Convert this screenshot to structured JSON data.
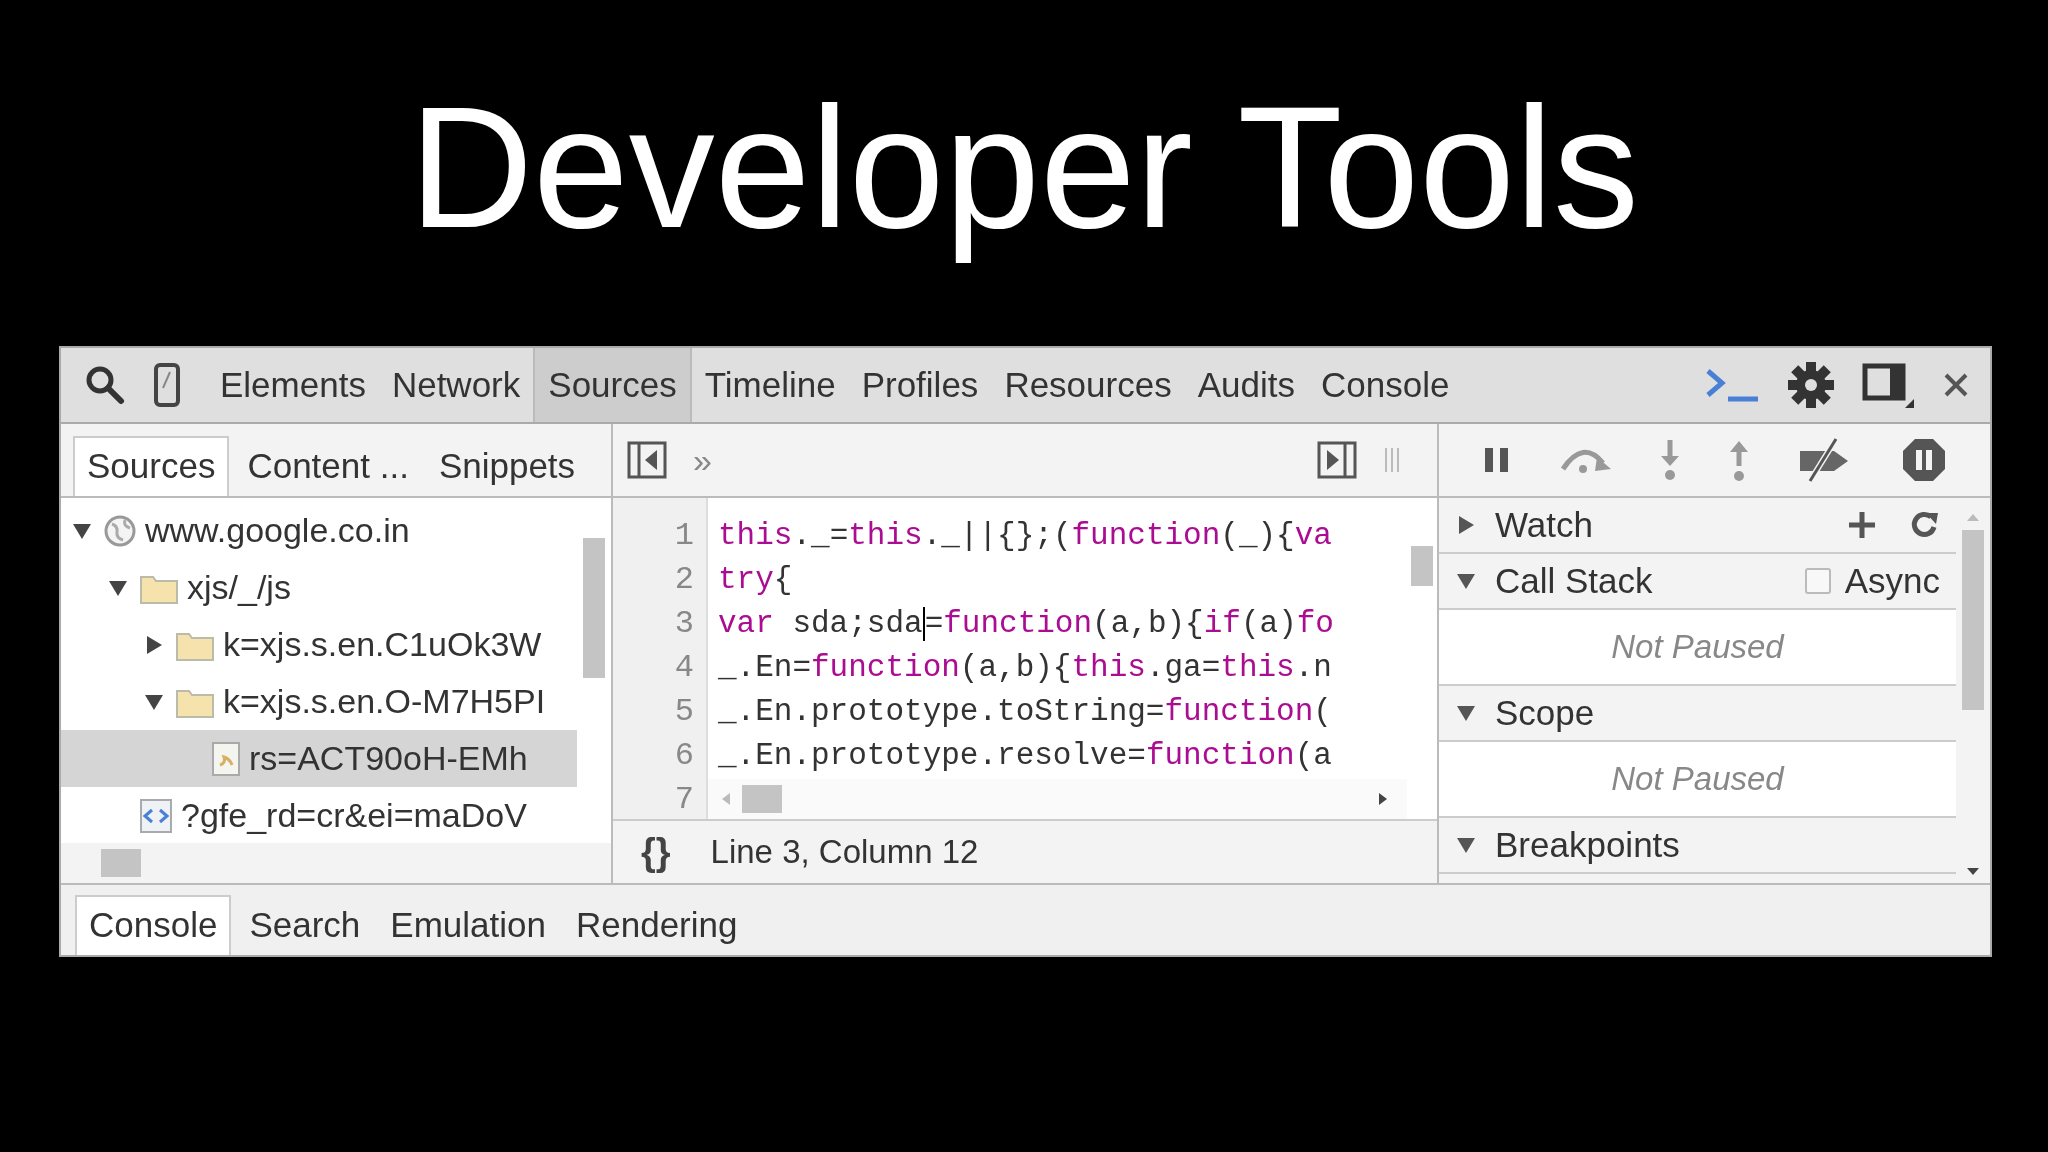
{
  "slide_title": "Developer Tools",
  "main_tabs": [
    {
      "label": "Elements",
      "selected": false
    },
    {
      "label": "Network",
      "selected": false
    },
    {
      "label": "Sources",
      "selected": true
    },
    {
      "label": "Timeline",
      "selected": false
    },
    {
      "label": "Profiles",
      "selected": false
    },
    {
      "label": "Resources",
      "selected": false
    },
    {
      "label": "Audits",
      "selected": false
    },
    {
      "label": "Console",
      "selected": false
    }
  ],
  "navigator": {
    "tabs": [
      {
        "label": "Sources",
        "selected": true
      },
      {
        "label": "Content ...",
        "selected": false
      },
      {
        "label": "Snippets",
        "selected": false
      }
    ],
    "tree": [
      {
        "label": "www.google.co.in",
        "kind": "domain",
        "expanded": true,
        "selected": false,
        "children": [
          {
            "label": "xjs/_/js",
            "kind": "folder",
            "expanded": true,
            "selected": false,
            "children": [
              {
                "label": "k=xjs.s.en.C1uOk3W",
                "kind": "folder",
                "expanded": false,
                "selected": false
              },
              {
                "label": "k=xjs.s.en.O-M7H5PI",
                "kind": "folder",
                "expanded": true,
                "selected": false,
                "children": [
                  {
                    "label": "rs=ACT90oH-EMh",
                    "kind": "script",
                    "selected": true
                  }
                ]
              }
            ]
          },
          {
            "label": "?gfe_rd=cr&ei=maDoV",
            "kind": "document",
            "selected": false
          }
        ]
      }
    ]
  },
  "editor": {
    "more_tabs": "»",
    "lines": [
      {
        "number": "1",
        "segments": [
          {
            "kind": "keyword",
            "text": "this"
          },
          {
            "kind": "plain",
            "text": "._="
          },
          {
            "kind": "keyword",
            "text": "this"
          },
          {
            "kind": "plain",
            "text": "._||{};("
          },
          {
            "kind": "keyword",
            "text": "function"
          },
          {
            "kind": "plain",
            "text": "(_){"
          },
          {
            "kind": "keyword",
            "text": "va"
          }
        ]
      },
      {
        "number": "2",
        "segments": [
          {
            "kind": "keyword",
            "text": "try"
          },
          {
            "kind": "plain",
            "text": "{"
          }
        ]
      },
      {
        "number": "3",
        "segments": [
          {
            "kind": "keyword",
            "text": "var"
          },
          {
            "kind": "plain",
            "text": " sda;sda"
          },
          {
            "kind": "caret"
          },
          {
            "kind": "plain",
            "text": "="
          },
          {
            "kind": "keyword",
            "text": "function"
          },
          {
            "kind": "plain",
            "text": "(a,b){"
          },
          {
            "kind": "keyword",
            "text": "if"
          },
          {
            "kind": "plain",
            "text": "(a)"
          },
          {
            "kind": "keyword",
            "text": "fo"
          }
        ]
      },
      {
        "number": "4",
        "segments": [
          {
            "kind": "plain",
            "text": "_.En="
          },
          {
            "kind": "keyword",
            "text": "function"
          },
          {
            "kind": "plain",
            "text": "(a,b){"
          },
          {
            "kind": "keyword",
            "text": "this"
          },
          {
            "kind": "plain",
            "text": ".ga="
          },
          {
            "kind": "keyword",
            "text": "this"
          },
          {
            "kind": "plain",
            "text": ".n"
          }
        ]
      },
      {
        "number": "5",
        "segments": [
          {
            "kind": "plain",
            "text": "_.En.prototype.toString="
          },
          {
            "kind": "keyword",
            "text": "function"
          },
          {
            "kind": "plain",
            "text": "("
          }
        ]
      },
      {
        "number": "6",
        "segments": [
          {
            "kind": "plain",
            "text": "_.En.prototype.resolve="
          },
          {
            "kind": "keyword",
            "text": "function"
          },
          {
            "kind": "plain",
            "text": "(a"
          }
        ]
      },
      {
        "number": "7"
      }
    ],
    "pretty_print": "{}",
    "status": "Line 3, Column 12"
  },
  "debugger": {
    "sections": [
      {
        "title": "Watch",
        "expanded": false,
        "actions": [
          {
            "kind": "add"
          },
          {
            "kind": "refresh"
          }
        ]
      },
      {
        "title": "Call Stack",
        "expanded": true,
        "option": {
          "label": "Async",
          "checked": false
        },
        "body": "Not Paused"
      },
      {
        "title": "Scope",
        "expanded": true,
        "body": "Not Paused"
      },
      {
        "title": "Breakpoints",
        "expanded": true
      }
    ]
  },
  "drawer_tabs": [
    {
      "label": "Console",
      "selected": true
    },
    {
      "label": "Search",
      "selected": false
    },
    {
      "label": "Emulation",
      "selected": false
    },
    {
      "label": "Rendering",
      "selected": false
    }
  ]
}
